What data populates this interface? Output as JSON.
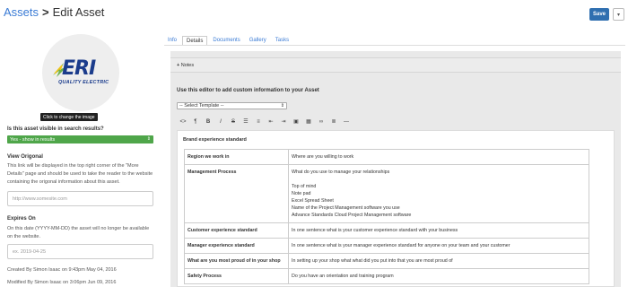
{
  "breadcrumb": {
    "parent": "Assets",
    "separator": ">",
    "current": "Edit Asset"
  },
  "header": {
    "save_label": "Save",
    "dropdown_glyph": "▾"
  },
  "image": {
    "logo_text": "ERI",
    "logo_subtext": "QUALITY ELECTRIC",
    "change_label": "Click to change the image"
  },
  "visibility": {
    "label": "Is this asset visible in search results?",
    "selected": "Yes - show in results"
  },
  "view_original": {
    "label": "View Origonal",
    "description": "This link will be displayed in the top right corner of the \"More Details\" page and should be used to take the reader to the website containing the origonal information about this asset.",
    "placeholder": "http://www.somesite.com"
  },
  "expires": {
    "label": "Expires On",
    "description": "On this date (YYYY-MM-DD) the asset will no longer be available on the website.",
    "placeholder": "ex. 2019-04-25"
  },
  "meta": {
    "created": "Created By Simon Isaac on 9:43pm May 04, 2016",
    "modified": "Modified By Simon Isaac on 3:06pm Jun 09, 2016"
  },
  "tabs": [
    "Info",
    "Details",
    "Documents",
    "Gallery",
    "Tasks"
  ],
  "active_tab": "Details",
  "notes": {
    "label": "Notes",
    "icon": "plus-icon"
  },
  "editor": {
    "instruction": "Use this editor to add custom information to your Asset",
    "template_select": "-- Select Template --",
    "toolbar": [
      {
        "name": "code-view-icon",
        "glyph": "<>"
      },
      {
        "name": "paragraph-icon",
        "glyph": "¶"
      },
      {
        "name": "bold-icon",
        "glyph": "B"
      },
      {
        "name": "italic-icon",
        "glyph": "I"
      },
      {
        "name": "strikethrough-icon",
        "glyph": "S"
      },
      {
        "name": "bullet-list-icon",
        "glyph": "☰"
      },
      {
        "name": "numbered-list-icon",
        "glyph": "≡"
      },
      {
        "name": "outdent-icon",
        "glyph": "⇤"
      },
      {
        "name": "indent-icon",
        "glyph": "⇥"
      },
      {
        "name": "image-icon",
        "glyph": "▣"
      },
      {
        "name": "table-icon",
        "glyph": "▦"
      },
      {
        "name": "link-icon",
        "glyph": "∞"
      },
      {
        "name": "align-icon",
        "glyph": "≣"
      },
      {
        "name": "horizontal-rule-icon",
        "glyph": "—"
      }
    ],
    "doc_title": "Brand experience standard",
    "rows": [
      {
        "key": "Region we work in",
        "value": [
          "Where are you willing to work"
        ]
      },
      {
        "key": "Management Process",
        "value": [
          "What do you use to manage your relationships",
          "",
          "Top of mind",
          "Note pad",
          "Excel Spread Sheet",
          "Name of the Project Management software you use",
          "Advance Standards Cloud Project Management software"
        ]
      },
      {
        "key": "Customer experience standard",
        "value": [
          "In one sentence what is your customer experience standard with your business"
        ]
      },
      {
        "key": "Manager experience standard",
        "value": [
          "In one sentence what is your manager experience standard for anyone on your team and your customer"
        ]
      },
      {
        "key": "What are you most proud of in your shop",
        "value": [
          "In setting up your shop what what did you put into that you are most proud of"
        ]
      },
      {
        "key": "Safety Process",
        "value": [
          "Do you have an orientation and training program"
        ]
      }
    ]
  }
}
